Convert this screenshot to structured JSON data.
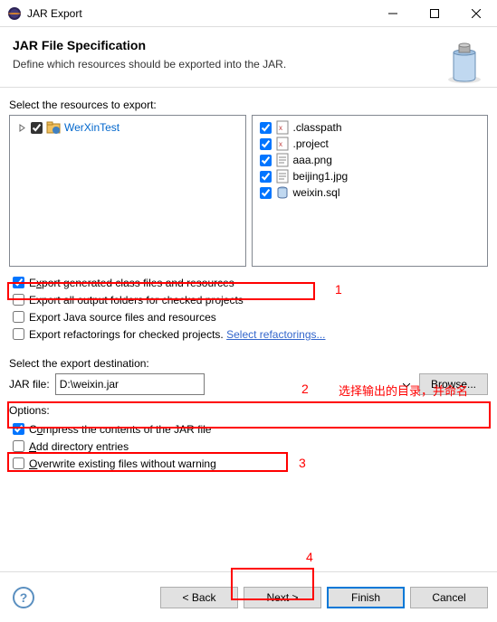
{
  "window": {
    "title": "JAR Export"
  },
  "header": {
    "title": "JAR File Specification",
    "subtitle": "Define which resources should be exported into the JAR."
  },
  "resources": {
    "label": "Select the resources to export:",
    "project": "WerXinTest",
    "files": [
      {
        "name": ".classpath",
        "icon": "xml"
      },
      {
        "name": ".project",
        "icon": "xml"
      },
      {
        "name": "aaa.png",
        "icon": "txt"
      },
      {
        "name": "beijing1.jpg",
        "icon": "txt"
      },
      {
        "name": "weixin.sql",
        "icon": "sql"
      }
    ]
  },
  "export_options": {
    "opt1": {
      "pre": "E",
      "u": "x",
      "post": "port generated class files and resources"
    },
    "opt2": "Export all output folders for checked projects",
    "opt3": "Export Java source files and resources",
    "opt4": {
      "text": "Export refactorings for checked projects.",
      "link": "Select refactorings..."
    }
  },
  "destination": {
    "label": "Select the export destination:",
    "jar_label": "JAR file:",
    "jar_value": "D:\\weixin.jar",
    "browse": "Browse..."
  },
  "options": {
    "group_label": "Options:",
    "compress": {
      "pre": "C",
      "u": "o",
      "post": "mpress the contents of the JAR file"
    },
    "adddir": {
      "u": "A",
      "post": "dd directory entries"
    },
    "overwrite": {
      "u": "O",
      "post": "verwrite existing files without warning"
    }
  },
  "buttons": {
    "back": "< Back",
    "next": "Next >",
    "finish": "Finish",
    "cancel": "Cancel"
  },
  "annotations": {
    "n1": "1",
    "n2": "2",
    "n3": "3",
    "n4": "4",
    "chinese": "选择输出的目录，并命名"
  }
}
